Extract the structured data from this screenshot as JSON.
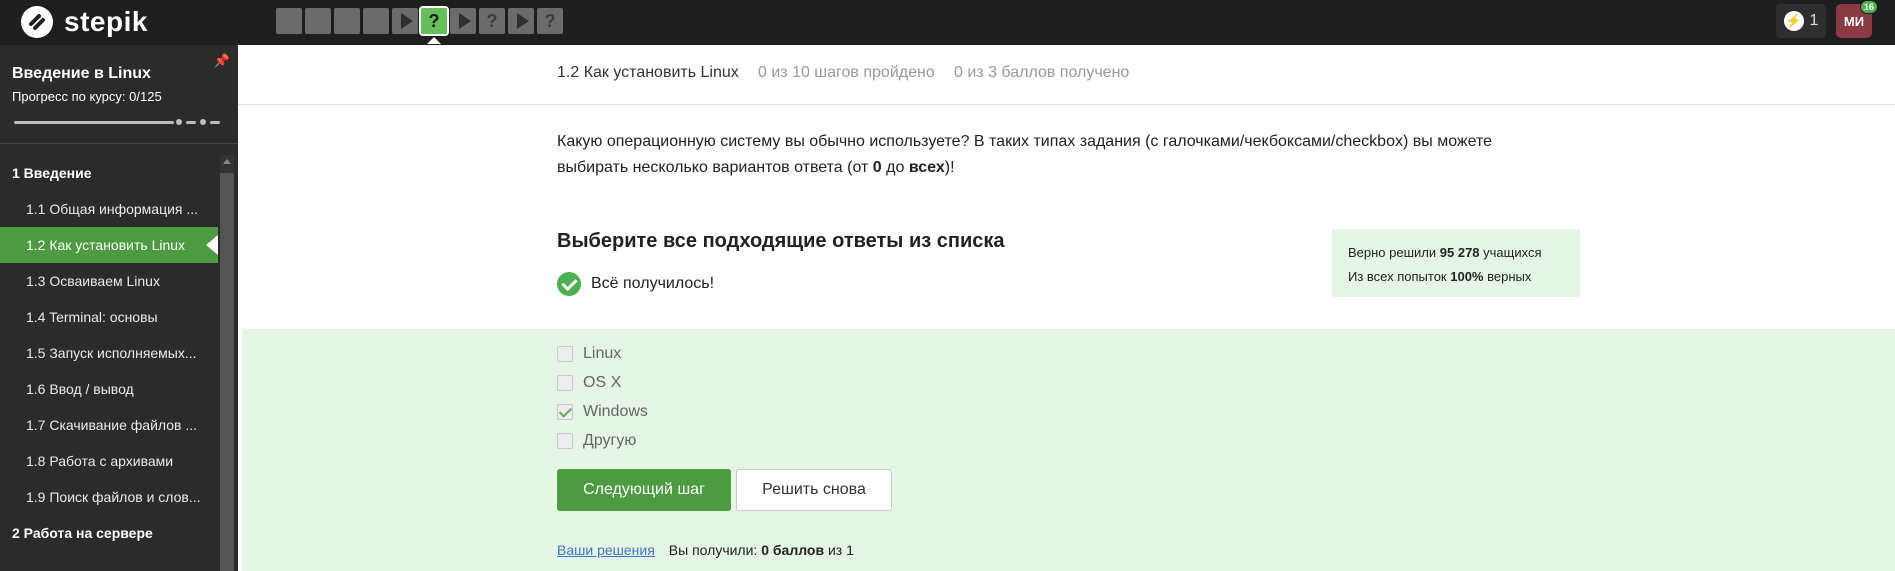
{
  "brand": {
    "name": "stepik"
  },
  "steps": [
    {
      "kind": "text",
      "state": "done"
    },
    {
      "kind": "text",
      "state": "done"
    },
    {
      "kind": "text",
      "state": "done"
    },
    {
      "kind": "text",
      "state": "done"
    },
    {
      "kind": "video",
      "state": "done"
    },
    {
      "kind": "quiz",
      "state": "active",
      "label": "?"
    },
    {
      "kind": "video",
      "state": "todo"
    },
    {
      "kind": "quiz",
      "state": "todo",
      "label": "?"
    },
    {
      "kind": "video",
      "state": "todo"
    },
    {
      "kind": "quiz",
      "state": "todo",
      "label": "?"
    }
  ],
  "notifications": {
    "count": "1"
  },
  "user": {
    "initials": "МИ",
    "badge": "16"
  },
  "sidebar": {
    "course_title": "Введение в Linux",
    "progress_label": "Прогресс по курсу:  0/125",
    "progress_fraction": 0,
    "modules": [
      {
        "title": "1  Введение",
        "lessons": [
          {
            "label": "1.1  Общая информация ...",
            "active": false
          },
          {
            "label": "1.2  Как установить Linux",
            "active": true
          },
          {
            "label": "1.3  Осваиваем Linux",
            "active": false
          },
          {
            "label": "1.4  Terminal: основы",
            "active": false
          },
          {
            "label": "1.5  Запуск исполняемых...",
            "active": false
          },
          {
            "label": "1.6  Ввод / вывод",
            "active": false
          },
          {
            "label": "1.7  Скачивание файлов ...",
            "active": false
          },
          {
            "label": "1.8  Работа с архивами",
            "active": false
          },
          {
            "label": "1.9  Поиск файлов и слов...",
            "active": false
          }
        ]
      },
      {
        "title": "2  Работа на сервере",
        "lessons": []
      }
    ]
  },
  "lesson_header": {
    "title": "1.2 Как установить Linux",
    "steps_done": "0 из 10 шагов пройдено",
    "points": "0 из 3 баллов  получено"
  },
  "question": {
    "text_part1": "Какую операционную систему вы обычно используете? В таких типах задания (с галочками/чекбоксами/checkbox) вы можете выбирать несколько вариантов ответа (от ",
    "bold_from": "0",
    "text_part2": " до ",
    "bold_to": "всех",
    "text_part3": ")!",
    "heading": "Выберите все подходящие ответы из списка",
    "success_text": "Всё получилось!"
  },
  "stats": {
    "line1_prefix": "Верно решили ",
    "line1_value": "95 278",
    "line1_suffix": " учащихся",
    "line2_prefix": "Из всех попыток ",
    "line2_value": "100%",
    "line2_suffix": " верных"
  },
  "options": [
    {
      "label": "Linux",
      "checked": false
    },
    {
      "label": "OS X",
      "checked": false
    },
    {
      "label": "Windows",
      "checked": true
    },
    {
      "label": "Другую",
      "checked": false
    }
  ],
  "buttons": {
    "next": "Следующий шаг",
    "again": "Решить снова"
  },
  "footer": {
    "solutions_link": "Ваши решения",
    "result_prefix": "Вы получили: ",
    "result_value": "0 баллов",
    "result_suffix": " из 1"
  }
}
